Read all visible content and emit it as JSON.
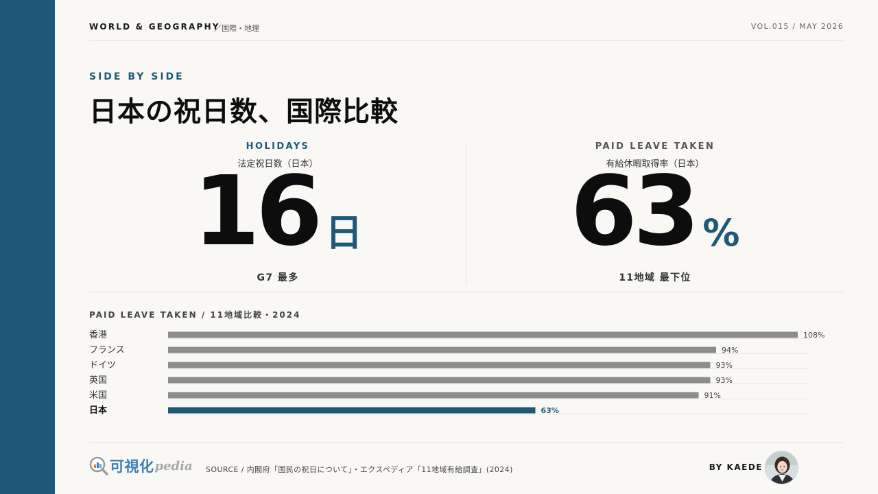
{
  "header": {
    "section": "WORLD & GEOGRAPHY",
    "subsection": "／国際・地理",
    "volume": "VOL.015 / MAY 2026"
  },
  "kicker": "SIDE BY SIDE",
  "title": "日本の祝日数、国際比較",
  "kpis": [
    {
      "label": "HOLIDAYS",
      "sublabel": "法定祝日数（日本）",
      "value": "16",
      "unit": "日",
      "note": "G7 最多"
    },
    {
      "label": "PAID LEAVE TAKEN",
      "sublabel": "有給休暇取得率（日本）",
      "value": "63",
      "unit": "%",
      "note": "11地域 最下位"
    }
  ],
  "chart_title": "PAID LEAVE TAKEN / 11地域比較・2024",
  "chart_data": {
    "type": "bar",
    "orientation": "horizontal",
    "title": "PAID LEAVE TAKEN / 11地域比較・2024",
    "categories": [
      "香港",
      "フランス",
      "ドイツ",
      "英国",
      "米国",
      "日本"
    ],
    "values": [
      108,
      94,
      93,
      93,
      91,
      63
    ],
    "value_labels": [
      "108%",
      "94%",
      "93%",
      "93%",
      "91%",
      "63%"
    ],
    "highlight": "日本",
    "xlim": [
      0,
      108
    ],
    "grid": false,
    "colors": {
      "default": "#8c8c8c",
      "highlight": "#1e5a78",
      "track": "#e6e4df"
    }
  },
  "footer": {
    "logo_text": "可視化",
    "logo_sub": "pedia",
    "source": "SOURCE / 内閣府「国民の祝日について」・エクスペディア「11地域有給調査」(2024)",
    "byline": "BY KAEDE"
  },
  "colors": {
    "accent": "#1e5a78",
    "background": "#f9f8f4"
  }
}
